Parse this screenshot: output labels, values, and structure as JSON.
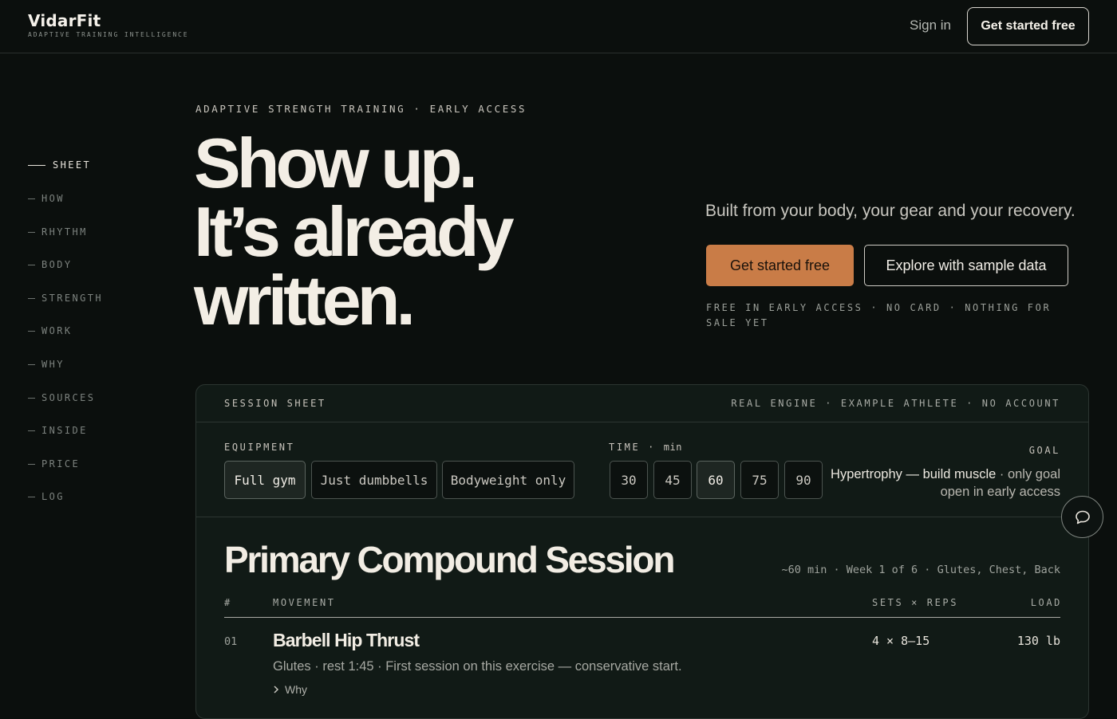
{
  "header": {
    "brand": "VidarFit",
    "tagline": "ADAPTIVE TRAINING INTELLIGENCE",
    "sign_in": "Sign in",
    "cta": "Get started free"
  },
  "nav": {
    "items": [
      {
        "label": "SHEET",
        "active": true
      },
      {
        "label": "HOW"
      },
      {
        "label": "RHYTHM"
      },
      {
        "label": "BODY"
      },
      {
        "label": "STRENGTH"
      },
      {
        "label": "WORK"
      },
      {
        "label": "WHY"
      },
      {
        "label": "SOURCES"
      },
      {
        "label": "INSIDE"
      },
      {
        "label": "PRICE"
      },
      {
        "label": "LOG"
      }
    ]
  },
  "hero": {
    "eyebrow": "ADAPTIVE STRENGTH TRAINING · EARLY ACCESS",
    "headline": [
      "Show up.",
      "It’s already",
      "written."
    ],
    "subhead": "Built from your body, your gear and your recovery.",
    "primary_cta": "Get started free",
    "secondary_cta": "Explore with sample data",
    "fine_print": "FREE IN EARLY ACCESS · NO CARD · NOTHING FOR SALE YET"
  },
  "sheet": {
    "title": "SESSION SHEET",
    "meta": "REAL ENGINE · EXAMPLE ATHLETE · NO ACCOUNT",
    "equipment": {
      "label": "EQUIPMENT",
      "options": [
        "Full gym",
        "Just dumbbells",
        "Bodyweight only"
      ],
      "selected": "Full gym"
    },
    "time": {
      "label": "TIME",
      "unit": "min",
      "options": [
        "30",
        "45",
        "60",
        "75",
        "90"
      ],
      "selected": "60"
    },
    "goal": {
      "label": "GOAL",
      "value": "Hypertrophy — build muscle",
      "note": " · only goal open in early access"
    },
    "session": {
      "title": "Primary Compound Session",
      "meta": "~60 min · Week 1 of 6 · Glutes, Chest, Back",
      "columns": {
        "num": "#",
        "movement": "MOVEMENT",
        "sets": "SETS × REPS",
        "load": "LOAD"
      },
      "rows": [
        {
          "num": "01",
          "name": "Barbell Hip Thrust",
          "sets": "4 × 8–15",
          "load": "130 lb",
          "desc": "Glutes · rest 1:45 · First session on this exercise — conservative start.",
          "why": "Why"
        }
      ]
    }
  },
  "icons": {
    "chat": "chat-bubble-icon",
    "why": "chevron-right-icon"
  },
  "colors": {
    "background": "#0b0f0d",
    "accent": "#c97c47",
    "panel": "#111a16"
  }
}
